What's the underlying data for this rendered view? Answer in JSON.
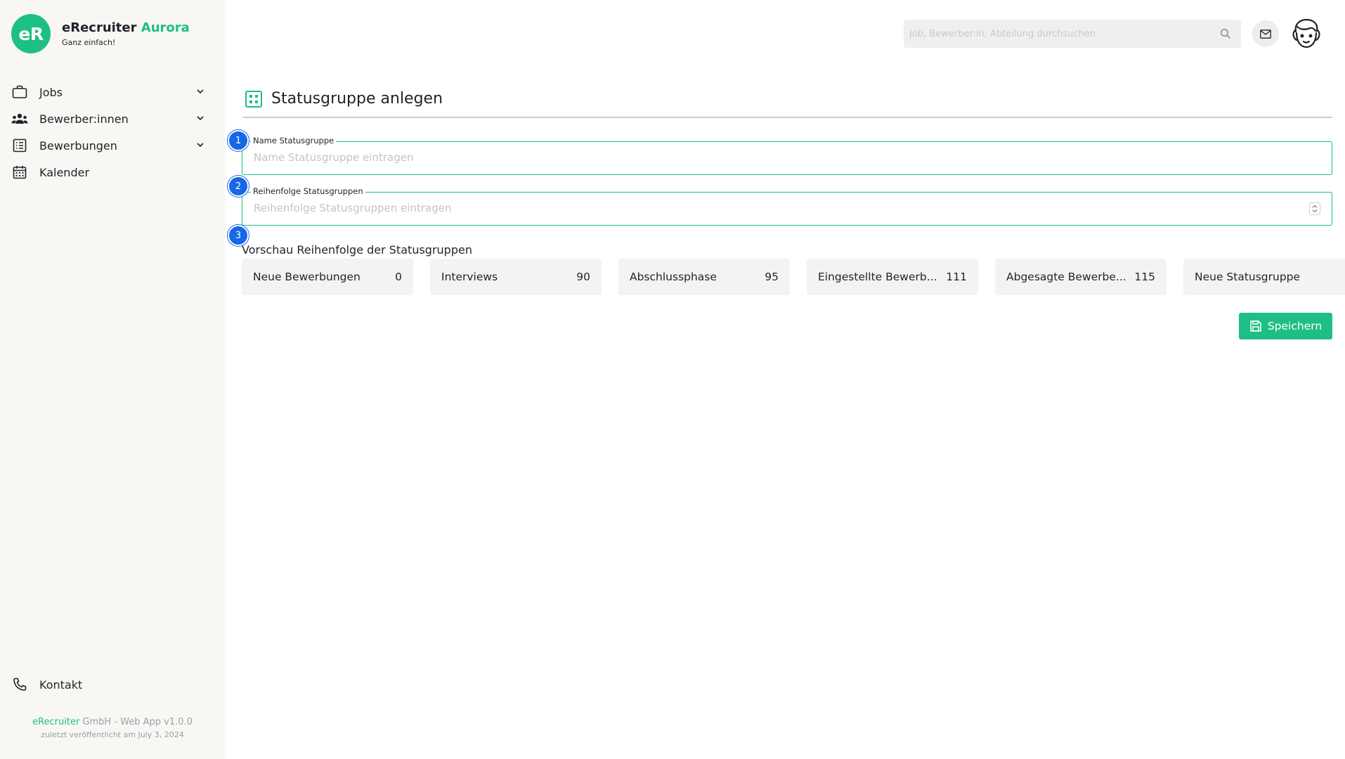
{
  "brand": {
    "logo_text": "eR",
    "name": "eRecruiter",
    "name_accent": "Aurora",
    "tagline": "Ganz einfach!",
    "accent_color": "#1dbf85"
  },
  "sidebar": {
    "items": [
      {
        "label": "Jobs",
        "icon": "briefcase-icon",
        "expandable": true
      },
      {
        "label": "Bewerber:innen",
        "icon": "people-icon",
        "expandable": true
      },
      {
        "label": "Bewerbungen",
        "icon": "list-document-icon",
        "expandable": true
      },
      {
        "label": "Kalender",
        "icon": "calendar-icon",
        "expandable": false
      }
    ],
    "contact": {
      "label": "Kontakt",
      "icon": "phone-icon"
    },
    "footer": {
      "company": "eRecruiter",
      "version_text": " GmbH - Web App v1.0.0",
      "published": "zuletzt veröffentlicht am July 3, 2024"
    }
  },
  "header": {
    "search_placeholder": "Job, Bewerber:in, Abteilung durchsuchen",
    "mail_icon": "mail-icon",
    "avatar_icon": "avatar-face-icon"
  },
  "main": {
    "title": "Statusgruppe anlegen",
    "title_icon": "grid-icon",
    "steps": [
      "1",
      "2",
      "3"
    ],
    "name_field": {
      "label": "Name Statusgruppe",
      "placeholder": "Name Statusgruppe eintragen",
      "value": ""
    },
    "order_field": {
      "label": "Reihenfolge Statusgruppen",
      "placeholder": "Reihenfolge Statusgruppen eintragen",
      "value": ""
    },
    "preview_label": "Vorschau Reihenfolge der Statusgruppen",
    "preview_groups": [
      {
        "name": "Neue Bewerbungen",
        "order": "0"
      },
      {
        "name": "Interviews",
        "order": "90"
      },
      {
        "name": "Abschlussphase",
        "order": "95"
      },
      {
        "name": "Eingestellte Bewerb...",
        "order": "111"
      },
      {
        "name": "Abgesagte Bewerbe...",
        "order": "115"
      },
      {
        "name": "Neue Statusgruppe",
        "order": ""
      }
    ],
    "save_label": "Speichern",
    "save_icon": "floppy-disk-icon",
    "step_color": "#1767e6"
  }
}
